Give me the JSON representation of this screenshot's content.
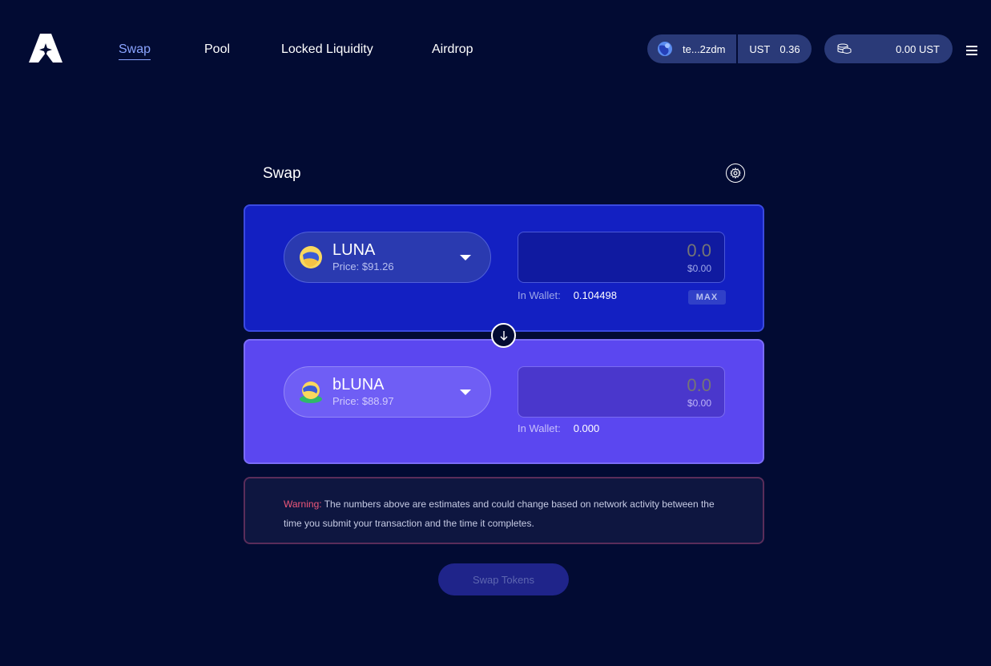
{
  "nav": {
    "items": [
      {
        "label": "Swap",
        "active": true
      },
      {
        "label": "Pool",
        "active": false
      },
      {
        "label": "Locked Liquidity",
        "active": false
      },
      {
        "label": "Airdrop",
        "active": false
      }
    ]
  },
  "wallet": {
    "address": "te...2zdm",
    "currency": "UST",
    "amount": "0.36",
    "balance": "0.00 UST"
  },
  "swap": {
    "title": "Swap",
    "from": {
      "symbol": "LUNA",
      "price": "Price: $91.26",
      "amount_placeholder": "0.0",
      "usd": "$0.00",
      "wallet_label": "In Wallet:",
      "wallet_value": "0.104498",
      "max_label": "MAX"
    },
    "to": {
      "symbol": "bLUNA",
      "price": "Price: $88.97",
      "amount_placeholder": "0.0",
      "usd": "$0.00",
      "wallet_label": "In Wallet:",
      "wallet_value": "0.000"
    },
    "warning_label": "Warning:",
    "warning_text": " The numbers above are estimates and could change based on network activity between the time you submit your transaction and the time it completes.",
    "submit_label": "Swap Tokens"
  },
  "colors": {
    "background": "#020b33",
    "from_card": "#1320c2",
    "to_card": "#5b47f0",
    "nav_active": "#8aa4ff",
    "warning": "#f0587a"
  }
}
